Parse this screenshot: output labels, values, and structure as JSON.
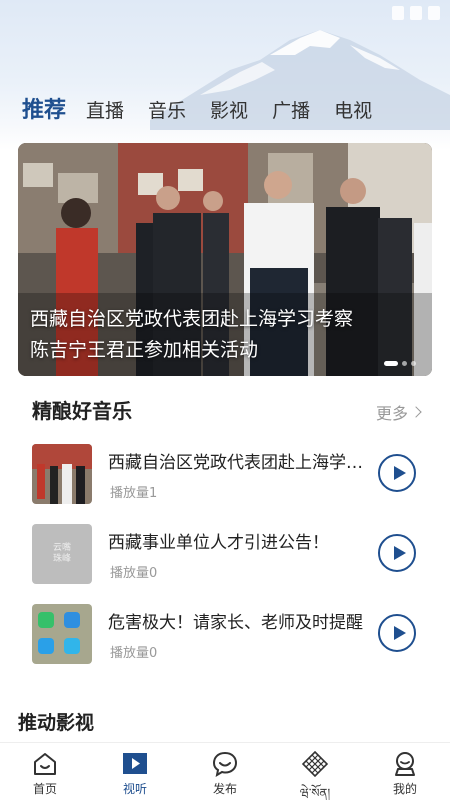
{
  "tabs": [
    {
      "label": "推荐",
      "active": true
    },
    {
      "label": "直播",
      "active": false
    },
    {
      "label": "音乐",
      "active": false
    },
    {
      "label": "影视",
      "active": false
    },
    {
      "label": "广播",
      "active": false
    },
    {
      "label": "电视",
      "active": false
    }
  ],
  "banner": {
    "caption_line1": "西藏自治区党政代表团赴上海学习考察",
    "caption_line2": "陈吉宁王君正参加相关活动"
  },
  "music_section": {
    "title": "精酿好音乐",
    "more_label": "更多"
  },
  "music_items": [
    {
      "title": "西藏自治区党政代表团赴上海学习考察",
      "plays": "播放量1"
    },
    {
      "title": "西藏事业单位人才引进公告！",
      "plays": "播放量0",
      "thumb_text1": "云嘴",
      "thumb_text2": "珠峰"
    },
    {
      "title": "危害极大！请家长、老师及时提醒",
      "plays": "播放量0"
    }
  ],
  "video_section": {
    "title": "推动影视"
  },
  "bottom_nav": [
    {
      "label": "首页",
      "icon": "home-icon",
      "active": false
    },
    {
      "label": "视听",
      "icon": "play-square-icon",
      "active": true
    },
    {
      "label": "发布",
      "icon": "chat-bubble-icon",
      "active": false
    },
    {
      "label": "ཝེ་སོན།",
      "icon": "endless-knot-icon",
      "active": false
    },
    {
      "label": "我的",
      "icon": "user-icon",
      "active": false
    }
  ],
  "colors": {
    "accent": "#1f4f8f",
    "muted": "#999999"
  }
}
